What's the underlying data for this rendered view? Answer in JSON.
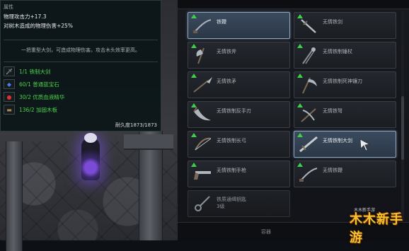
{
  "tooltip": {
    "attr_label": "属性",
    "stats": [
      "物理攻击力+17.3",
      "对树木造成的物理伤害+25%"
    ],
    "description": "一把重型大剑，可造成物理伤害。攻击木头效率更高。",
    "materials": [
      {
        "text": "1/1 铁制大剑",
        "icon": "sword-icon",
        "glyph": "🗡"
      },
      {
        "text": "60/1 普通蓝宝石",
        "icon": "sapphire-icon",
        "glyph": "◆"
      },
      {
        "text": "30/2 优质血液精华",
        "icon": "blood-essence-icon",
        "glyph": "●"
      },
      {
        "text": "136/2 加固木板",
        "icon": "plank-icon",
        "glyph": "▬"
      }
    ],
    "durability": "耐久度1873/1873"
  },
  "inventory": {
    "items": [
      {
        "name": "铁鞭",
        "icon": "whip-icon",
        "upgrade": true,
        "state": "selected"
      },
      {
        "name": "无情铁剑",
        "icon": "sword-icon",
        "upgrade": true,
        "state": "normal"
      },
      {
        "name": "无情铁斧",
        "icon": "axe-icon",
        "upgrade": true,
        "state": "normal"
      },
      {
        "name": "无情铁制锤杖",
        "icon": "mace-icon",
        "upgrade": true,
        "state": "normal"
      },
      {
        "name": "无情铁矛",
        "icon": "spear-icon",
        "upgrade": true,
        "state": "normal"
      },
      {
        "name": "无情铁制死神镰刀",
        "icon": "scythe-icon",
        "upgrade": true,
        "state": "normal"
      },
      {
        "name": "无情铁制反手刃",
        "icon": "reaper-blade-icon",
        "upgrade": true,
        "state": "normal"
      },
      {
        "name": "无情铁弩",
        "icon": "crossbow-icon",
        "upgrade": true,
        "state": "normal"
      },
      {
        "name": "无情铁制长弓",
        "icon": "longbow-icon",
        "upgrade": true,
        "state": "normal"
      },
      {
        "name": "无情铁制大剑",
        "icon": "greatsword-icon",
        "upgrade": true,
        "state": "selected"
      },
      {
        "name": "无情铁制手枪",
        "icon": "pistol-icon",
        "upgrade": true,
        "state": "normal"
      },
      {
        "name": "无情铁鞭",
        "icon": "whip-icon",
        "upgrade": true,
        "state": "normal"
      },
      {
        "name": "铁质通缉钥匙",
        "name2": "3级",
        "icon": "key-icon",
        "upgrade": false,
        "state": "dim"
      }
    ],
    "footer_label": "容器"
  },
  "watermark": {
    "text": "木木新手游",
    "small": "木木新手游"
  },
  "colors": {
    "upgrade": "#3fcf4a",
    "material_text": "#4ad04a",
    "selected_border": "#8ea6bf"
  }
}
